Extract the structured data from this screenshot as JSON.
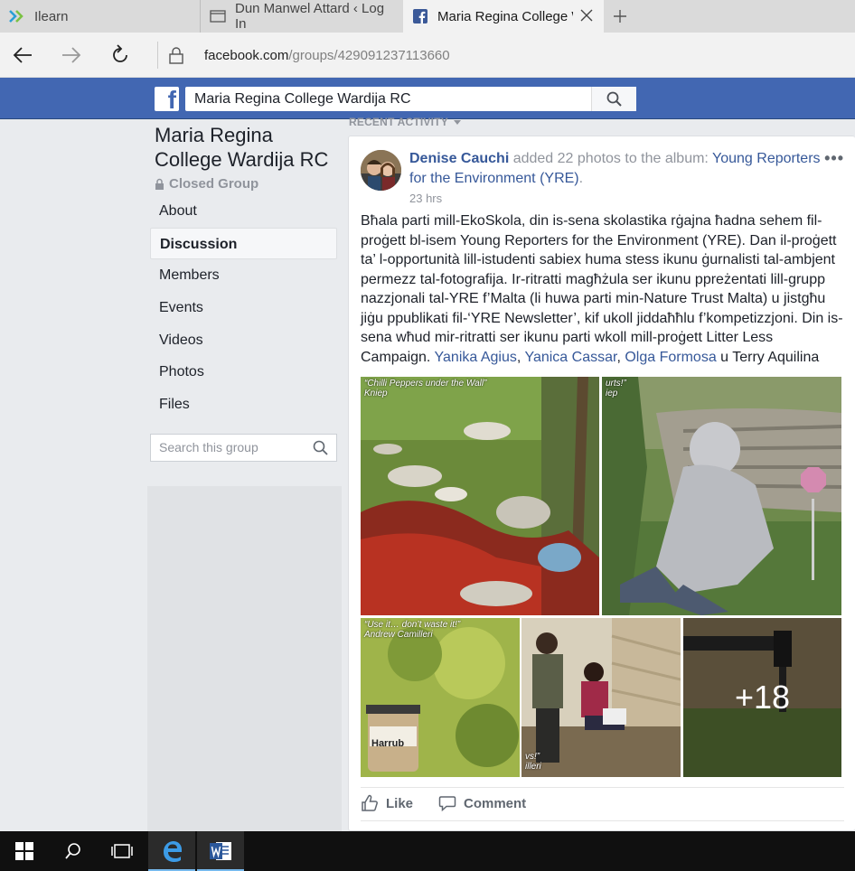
{
  "browser": {
    "tabs": [
      {
        "label": "Ilearn",
        "icon": "ilearn-icon"
      },
      {
        "label": "Dun Manwel Attard ‹ Log In",
        "icon": "page-icon"
      },
      {
        "label": "Maria Regina College W",
        "icon": "facebook-icon",
        "active": true
      }
    ],
    "url_host": "facebook.com",
    "url_path": "/groups/429091237113660"
  },
  "fb": {
    "search_value": "Maria Regina College Wardija RC",
    "brand_color": "#4267b2"
  },
  "group": {
    "name": "Maria Regina College Wardija RC",
    "privacy": "Closed Group",
    "nav": [
      "About",
      "Discussion",
      "Members",
      "Events",
      "Videos",
      "Photos",
      "Files"
    ],
    "active_nav": "Discussion",
    "search_placeholder": "Search this group"
  },
  "feed": {
    "section_label": "RECENT ACTIVITY"
  },
  "post": {
    "author": "Denise Cauchi",
    "action": " added 22 photos to the album: ",
    "album": "Young Reporters for the Environment (YRE)",
    "album_suffix": ".",
    "time": "23 hrs",
    "text": "Bħala parti mill-EkoSkola, din is-sena skolastika rġajna ħadna sehem fil-proġett bl-isem Young Reporters for the Environment (YRE). Dan il-proġett ta’ l-opportunità lill-istudenti sabiex huma stess ikunu ġurnalisti tal-ambjent permezz tal-fotografija. Ir-ritratti magħżula ser ikunu ppreżentati lill-grupp nazzjonali tal-YRE f’Malta (li huwa parti min-Nature Trust Malta) u jistgħu jiġu ppublikati fil-‘YRE Newsletter’, kif ukoll jiddaħħlu f’kompetizzjoni. Din is-sena wħud mir-ritratti ser ikunu parti wkoll mill-proġett Litter Less Campaign. ",
    "tagged": [
      "Yanika Agius",
      "Yanica Cassar",
      "Olga Formosa"
    ],
    "sep1": ", ",
    "sep2": ", ",
    "sep3": " u ",
    "last_person": "Terry Aquilina",
    "photo_captions": [
      "“Chilli Peppers under the Wall”\nKniep",
      "urts!”\niep",
      "“Use it… don’t waste it!”\nAndrew Camilleri",
      "vs!”\nilleri"
    ],
    "jar_label": "Harrub",
    "more_count": "+18",
    "like_label": "Like",
    "comment_label": "Comment"
  }
}
